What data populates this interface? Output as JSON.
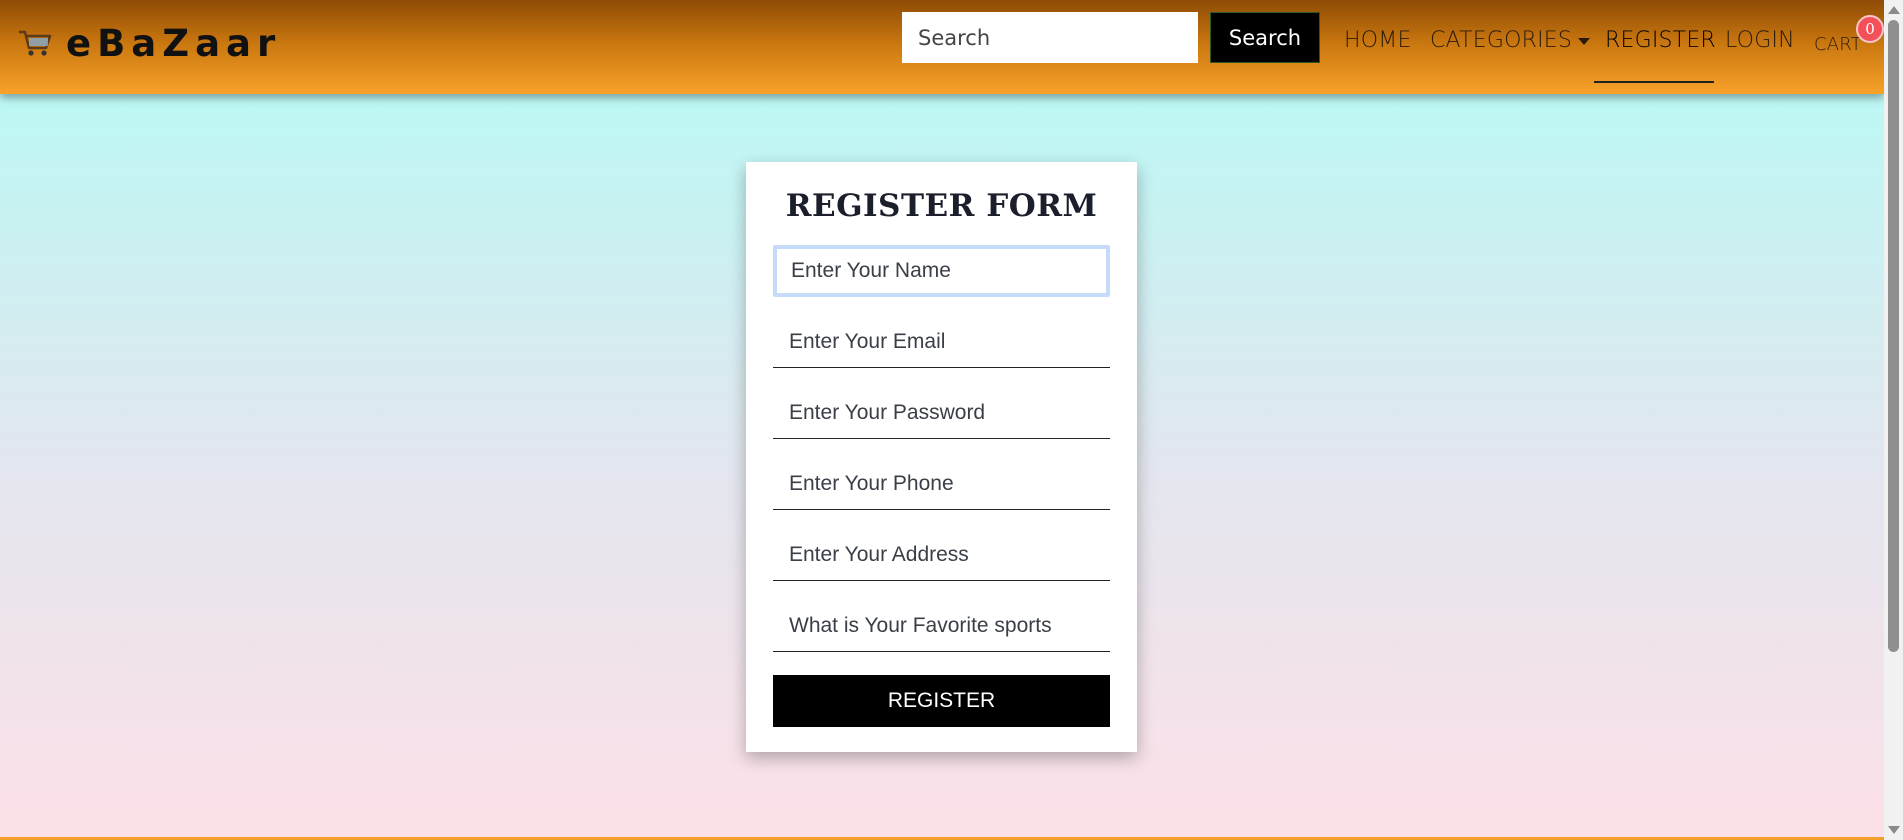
{
  "brand": {
    "name": "eBaZaar",
    "icon": "shopping-cart-icon"
  },
  "search": {
    "placeholder": "Search",
    "button_label": "Search"
  },
  "nav": {
    "home": "HOME",
    "categories": "CATEGORIES",
    "register": "REGISTER",
    "login": "LOGIN",
    "cart": "CART",
    "cart_count": "0",
    "active": "REGISTER"
  },
  "form": {
    "title": "REGISTER FORM",
    "fields": {
      "name": "Enter Your Name",
      "email": "Enter Your Email",
      "password": "Enter Your Password",
      "phone": "Enter Your Phone",
      "address": "Enter Your Address",
      "sports": "What is Your Favorite sports"
    },
    "submit_label": "REGISTER"
  },
  "colors": {
    "navbar_top": "#8e4b05",
    "navbar_bottom": "#f8a22a",
    "background_top": "#b2fcf6",
    "background_bottom": "#fde0e8",
    "badge": "#f4505a",
    "focus_ring": "#c6dbfa"
  }
}
